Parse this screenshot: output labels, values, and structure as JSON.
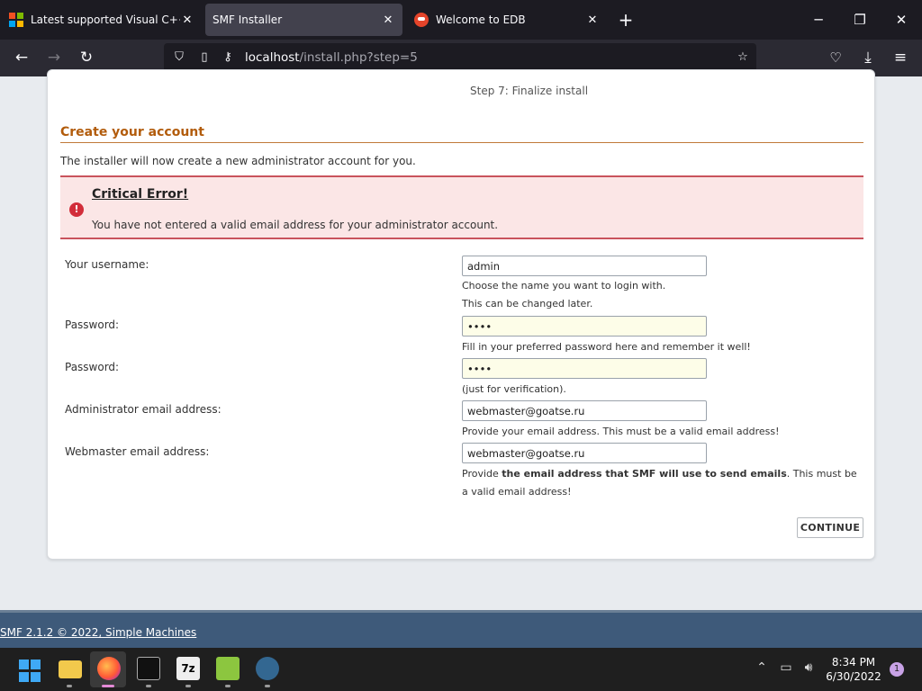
{
  "browser": {
    "tabs": [
      {
        "label": "Latest supported Visual C++ Re",
        "active": false,
        "icon": "microsoft-icon"
      },
      {
        "label": "SMF Installer",
        "active": true,
        "icon": "none"
      },
      {
        "label": "Welcome to EDB",
        "active": false,
        "icon": "edb-icon"
      }
    ],
    "url_host": "localhost",
    "url_path": "/install.php?step=5"
  },
  "installer": {
    "step_text": "Step 7: Finalize install",
    "section_title": "Create your account",
    "intro": "The installer will now create a new administrator account for you.",
    "error_title": "Critical Error!",
    "error_message": "You have not entered a valid email address for your administrator account.",
    "fields": {
      "username_label": "Your username:",
      "username_value": "admin",
      "username_hint1": "Choose the name you want to login with.",
      "username_hint2": "This can be changed later.",
      "password_label": "Password:",
      "password_value": "••••",
      "password_hint": "Fill in your preferred password here and remember it well!",
      "password2_label": "Password:",
      "password2_value": "••••",
      "password2_hint": "(just for verification).",
      "admin_email_label": "Administrator email address:",
      "admin_email_value": "webmaster@goatse.ru",
      "admin_email_hint": "Provide your email address. This must be a valid email address!",
      "webmaster_email_label": "Webmaster email address:",
      "webmaster_email_value": "webmaster@goatse.ru",
      "webmaster_hint_pre": "Provide ",
      "webmaster_hint_bold": "the email address that SMF will use to send emails",
      "webmaster_hint_post": ". This must be a valid email address!"
    },
    "continue_label": "CONTINUE",
    "footer_link": "SMF 2.1.2 © 2022, Simple Machines"
  },
  "taskbar": {
    "time": "8:34 PM",
    "date": "6/30/2022",
    "notification_count": "1"
  },
  "colors": {
    "accent_title": "#b25c0c",
    "error_border": "#c9535c",
    "error_bg": "#fbe6e6",
    "footer_bg": "#3e5a7a"
  }
}
